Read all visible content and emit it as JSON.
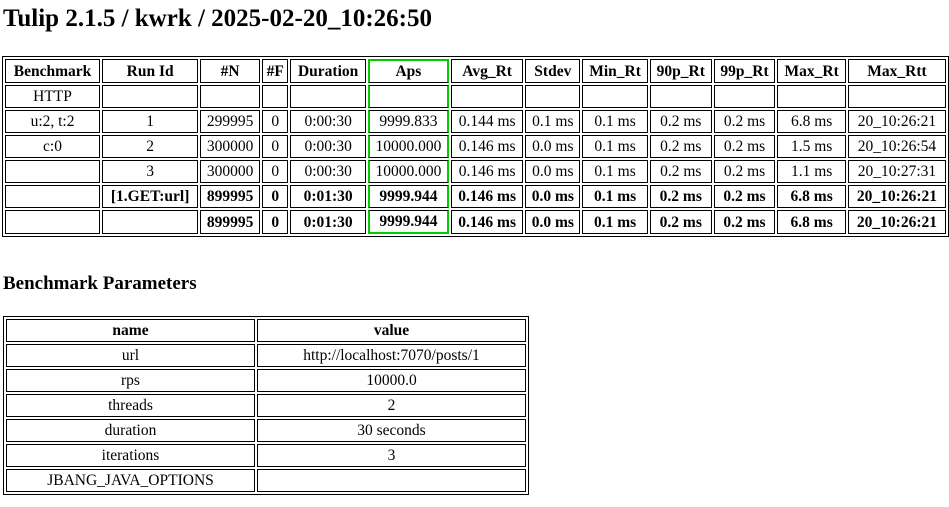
{
  "title": "Tulip 2.1.5 / kwrk / 2025-02-20_10:26:50",
  "accent_color": "#00cc00",
  "results": {
    "headers": [
      "Benchmark",
      "Run Id",
      "#N",
      "#F",
      "Duration",
      "Aps",
      "Avg_Rt",
      "Stdev",
      "Min_Rt",
      "90p_Rt",
      "99p_Rt",
      "Max_Rt",
      "Max_Rtt"
    ],
    "rows": [
      [
        "HTTP",
        "",
        "",
        "",
        "",
        "",
        "",
        "",
        "",
        "",
        "",
        "",
        ""
      ],
      [
        "u:2, t:2",
        "1",
        "299995",
        "0",
        "0:00:30",
        "9999.833",
        "0.144 ms",
        "0.1 ms",
        "0.1 ms",
        "0.2 ms",
        "0.2 ms",
        "6.8 ms",
        "20_10:26:21"
      ],
      [
        "c:0",
        "2",
        "300000",
        "0",
        "0:00:30",
        "10000.000",
        "0.146 ms",
        "0.0 ms",
        "0.1 ms",
        "0.2 ms",
        "0.2 ms",
        "1.5 ms",
        "20_10:26:54"
      ],
      [
        "",
        "3",
        "300000",
        "0",
        "0:00:30",
        "10000.000",
        "0.146 ms",
        "0.0 ms",
        "0.1 ms",
        "0.2 ms",
        "0.2 ms",
        "1.1 ms",
        "20_10:27:31"
      ],
      [
        "",
        "[1.GET:url]",
        "899995",
        "0",
        "0:01:30",
        "9999.944",
        "0.146 ms",
        "0.0 ms",
        "0.1 ms",
        "0.2 ms",
        "0.2 ms",
        "6.8 ms",
        "20_10:26:21"
      ],
      [
        "",
        "",
        "899995",
        "0",
        "0:01:30",
        "9999.944",
        "0.146 ms",
        "0.0 ms",
        "0.1 ms",
        "0.2 ms",
        "0.2 ms",
        "6.8 ms",
        "20_10:26:21"
      ]
    ]
  },
  "params": {
    "heading": "Benchmark Parameters",
    "headers": [
      "name",
      "value"
    ],
    "rows": [
      [
        "url",
        "http://localhost:7070/posts/1"
      ],
      [
        "rps",
        "10000.0"
      ],
      [
        "threads",
        "2"
      ],
      [
        "duration",
        "30 seconds"
      ],
      [
        "iterations",
        "3"
      ],
      [
        "JBANG_JAVA_OPTIONS",
        ""
      ]
    ]
  }
}
